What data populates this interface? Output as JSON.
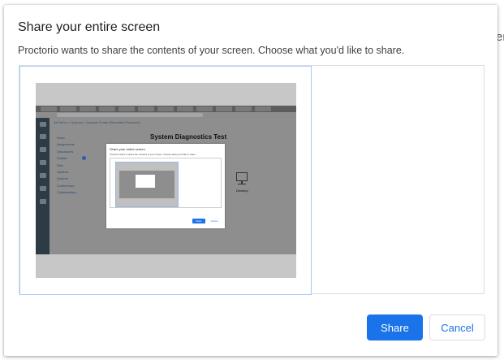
{
  "background": {
    "edge_text": "er"
  },
  "dialog": {
    "title": "Share your entire screen",
    "subtitle": "Proctorio wants to share the contents of your screen. Choose what you'd like to share.",
    "share_label": "Share",
    "cancel_label": "Cancel"
  },
  "thumbnail": {
    "breadcrumb": "Art Demo  >  Quizzes  >  Support Center (Remotely Proctored)",
    "heading": "System Diagnostics Test",
    "nav_items": [
      "Home",
      "Assignments",
      "Discussions",
      "Grades",
      "Files",
      "Syllabus",
      "Quizzes",
      "Conferences",
      "Collaborations"
    ],
    "desktop_label": "Desktop",
    "mini_dialog": {
      "title": "Share your entire screen",
      "subtitle": "Proctorio wants to share the contents of your screen. Choose what you'd like to share.",
      "share_label": "Share",
      "cancel_label": "Cancel"
    }
  },
  "colors": {
    "accent": "#1a73e8",
    "selection_border": "#a8c7fa",
    "sidebar": "#2d3b45"
  }
}
